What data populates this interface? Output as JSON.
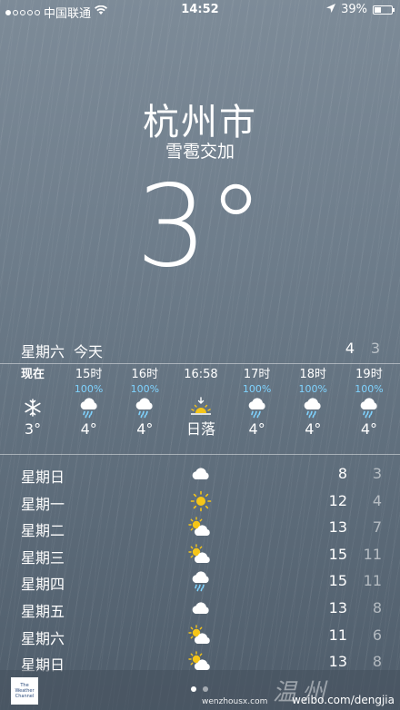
{
  "status_bar": {
    "carrier": "中国联通",
    "time": "14:52",
    "battery": "39%",
    "battery_level": 0.39,
    "signal_bars": 1
  },
  "location": {
    "city": "杭州市",
    "condition": "雪雹交加",
    "temperature": "3°"
  },
  "today": {
    "day": "星期六",
    "label": "今天",
    "high": "4",
    "low": "3"
  },
  "hourly": [
    {
      "time": "现在",
      "precip": "",
      "icon": "snowflake-icon",
      "temp": "3°"
    },
    {
      "time": "15时",
      "precip": "100%",
      "icon": "rain-cloud-icon",
      "temp": "4°"
    },
    {
      "time": "16时",
      "precip": "100%",
      "icon": "rain-cloud-icon",
      "temp": "4°"
    },
    {
      "time": "16:58",
      "precip": "",
      "icon": "sunset-icon",
      "temp": "日落"
    },
    {
      "time": "17时",
      "precip": "100%",
      "icon": "rain-cloud-icon",
      "temp": "4°"
    },
    {
      "time": "18时",
      "precip": "100%",
      "icon": "rain-cloud-icon",
      "temp": "4°"
    },
    {
      "time": "19时",
      "precip": "100%",
      "icon": "rain-cloud-icon",
      "temp": "4°"
    }
  ],
  "daily": [
    {
      "day": "星期日",
      "icon": "cloud-icon",
      "high": "8",
      "low": "3"
    },
    {
      "day": "星期一",
      "icon": "sun-icon",
      "high": "12",
      "low": "4"
    },
    {
      "day": "星期二",
      "icon": "partly-cloudy-icon",
      "high": "13",
      "low": "7"
    },
    {
      "day": "星期三",
      "icon": "partly-cloudy-icon",
      "high": "15",
      "low": "11"
    },
    {
      "day": "星期四",
      "icon": "rain-cloud-icon",
      "high": "15",
      "low": "11"
    },
    {
      "day": "星期五",
      "icon": "cloud-icon",
      "high": "13",
      "low": "8"
    },
    {
      "day": "星期六",
      "icon": "partly-cloudy-icon",
      "high": "11",
      "low": "6"
    },
    {
      "day": "星期日",
      "icon": "partly-cloudy-icon",
      "high": "13",
      "low": "8"
    }
  ],
  "footer": {
    "provider": "The Weather Channel",
    "watermark_site": "wenzhousx.com",
    "watermark_weibo": "weibo.com/dengjia"
  },
  "colors": {
    "precip": "#7fd3ff",
    "sun": "#f5c518",
    "background_top": "#7d8b98",
    "background_bottom": "#4f5d6b"
  }
}
